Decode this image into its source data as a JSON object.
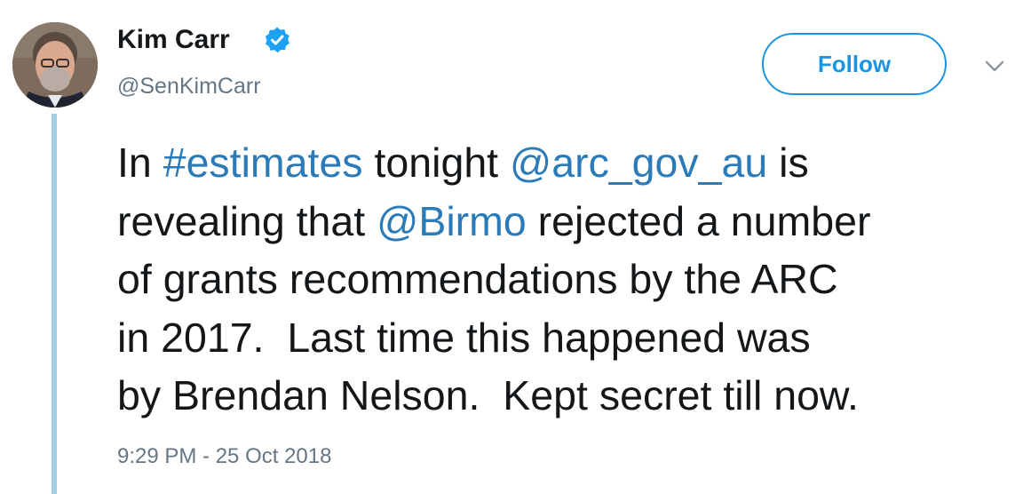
{
  "author": {
    "display_name": "Kim Carr",
    "handle": "@SenKimCarr",
    "verified": true,
    "verified_icon": "verified-badge-icon",
    "avatar_icon": "profile-photo"
  },
  "actions": {
    "follow_label": "Follow",
    "more_icon": "chevron-down-icon"
  },
  "tweet": {
    "lines": [
      [
        {
          "text": "In ",
          "type": "text"
        },
        {
          "text": "#estimates",
          "type": "link"
        },
        {
          "text": " tonight ",
          "type": "text"
        },
        {
          "text": "@arc_gov_au",
          "type": "link"
        },
        {
          "text": " is",
          "type": "text"
        }
      ],
      [
        {
          "text": "revealing that ",
          "type": "text"
        },
        {
          "text": "@Birmo",
          "type": "link"
        },
        {
          "text": " rejected a number",
          "type": "text"
        }
      ],
      [
        {
          "text": "of grants recommendations by the ARC",
          "type": "text"
        }
      ],
      [
        {
          "text": "in 2017.  Last time this happened was",
          "type": "text"
        }
      ],
      [
        {
          "text": "by Brendan Nelson.  Kept secret till now.",
          "type": "text"
        }
      ]
    ],
    "timestamp": "9:29 PM - 25 Oct 2018"
  },
  "colors": {
    "link": "#2b7bb9",
    "follow_accent": "#1b95e0",
    "secondary_text": "#657786",
    "primary_text": "#14171a",
    "thread_line": "#a3cde0"
  }
}
